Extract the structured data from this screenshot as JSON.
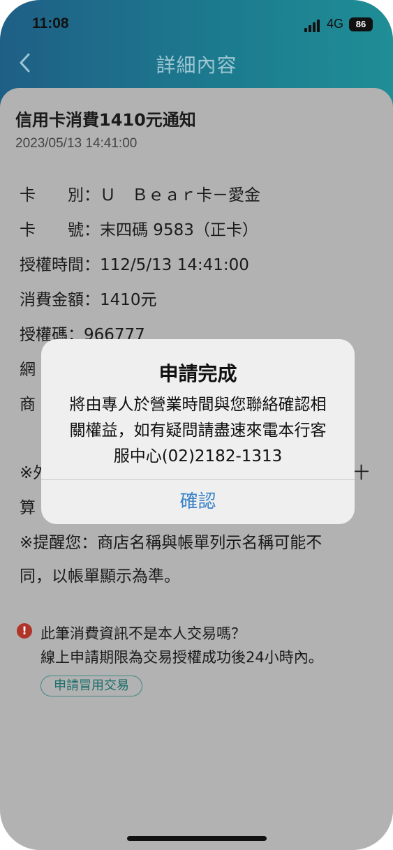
{
  "status_bar": {
    "time": "11:08",
    "network": "4G",
    "battery": "86"
  },
  "header": {
    "title": "詳細內容"
  },
  "notice": {
    "title": "信用卡消費1410元通知",
    "datetime": "2023/05/13 14:41:00",
    "lines": [
      "卡　　別：Ｕ　Ｂｅａｒ卡－愛金",
      "卡　　號：末四碼 9583（正卡）",
      "授權時間：112/5/13 14:41:00",
      "消費金額：1410元",
      "授權碼：966777",
      "網",
      "商",
      "※外",
      "算",
      "※提醒您：商店名稱與帳單列示名稱可能不",
      "同，以帳單顯示為準。"
    ],
    "line_right_frag": "十"
  },
  "fraud": {
    "question": "此筆消費資訊不是本人交易嗎？",
    "hint": "線上申請期限為交易授權成功後24小時內。",
    "apply_button": "申請冒用交易"
  },
  "dialog": {
    "title": "申請完成",
    "body": "將由專人於營業時間與您聯絡確認相關權益，如有疑問請盡速來電本行客服中心(02)2182-1313",
    "confirm": "確認"
  }
}
